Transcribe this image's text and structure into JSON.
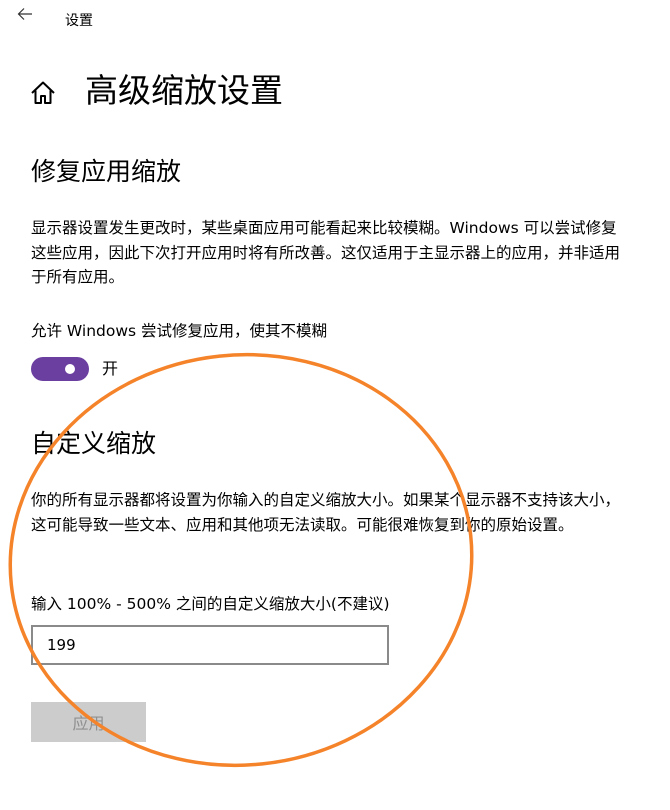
{
  "header": {
    "window_title": "设置"
  },
  "page": {
    "title": "高级缩放设置"
  },
  "fix_scaling": {
    "title": "修复应用缩放",
    "description": "显示器设置发生更改时，某些桌面应用可能看起来比较模糊。Windows 可以尝试修复这些应用，因此下次打开应用时将有所改善。这仅适用于主显示器上的应用，并非适用于所有应用。",
    "toggle_label": "允许 Windows 尝试修复应用，使其不模糊",
    "toggle_state": "开",
    "toggle_on": true,
    "toggle_color": "#6b3fa0"
  },
  "custom_scaling": {
    "title": "自定义缩放",
    "description": "你的所有显示器都将设置为你输入的自定义缩放大小。如果某个显示器不支持该大小，这可能导致一些文本、应用和其他项无法读取。可能很难恢复到你的原始设置。",
    "input_label": "输入 100% - 500% 之间的自定义缩放大小(不建议)",
    "input_value": "199",
    "apply_label": "应用"
  },
  "annotation": {
    "color": "#f5832a"
  },
  "icons": {
    "back": "back-arrow-icon",
    "home": "home-icon"
  }
}
